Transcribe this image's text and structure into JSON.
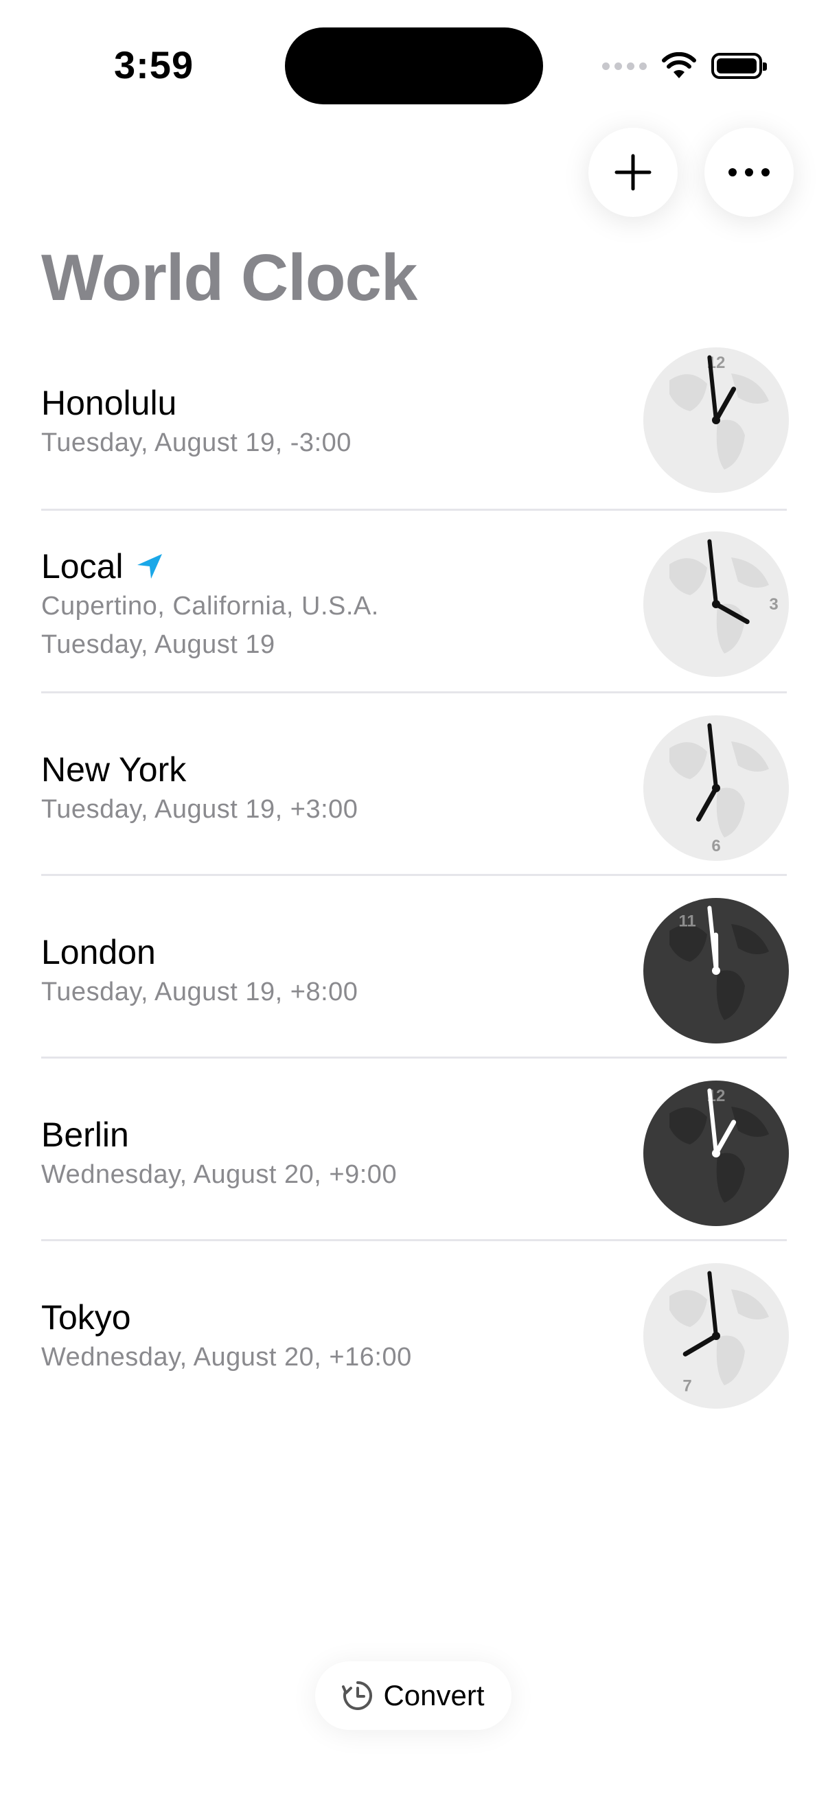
{
  "status": {
    "time": "3:59"
  },
  "header": {
    "title": "World Clock",
    "add_icon": "plus-icon",
    "more_icon": "ellipsis-icon"
  },
  "clocks": [
    {
      "city": "Honolulu",
      "line1": "Tuesday, August 19, -3:00",
      "line2": "",
      "hour": 12,
      "minute": 59,
      "dial_label": "12",
      "dark": false
    },
    {
      "city": "Local",
      "line1": "Cupertino, California, U.S.A.",
      "line2": "Tuesday, August 19",
      "hour": 3,
      "minute": 59,
      "dial_label": "3",
      "dark": false,
      "location_icon": "location-arrow-icon"
    },
    {
      "city": "New York",
      "line1": "Tuesday, August 19, +3:00",
      "line2": "",
      "hour": 6,
      "minute": 59,
      "dial_label": "6",
      "dark": false
    },
    {
      "city": "London",
      "line1": "Tuesday, August 19, +8:00",
      "line2": "",
      "hour": 11,
      "minute": 59,
      "dial_label": "11",
      "dark": true
    },
    {
      "city": "Berlin",
      "line1": "Wednesday, August 20, +9:00",
      "line2": "",
      "hour": 12,
      "minute": 59,
      "dial_label": "12",
      "dark": true
    },
    {
      "city": "Tokyo",
      "line1": "Wednesday, August 20, +16:00",
      "line2": "",
      "hour": 7,
      "minute": 59,
      "dial_label": "7",
      "dark": false
    }
  ],
  "footer": {
    "convert_label": "Convert",
    "convert_icon": "clock-arrow-icon"
  },
  "colors": {
    "accent": "#1aa7e8",
    "title_gray": "#86868b",
    "dark_face": "#3a3a3a",
    "light_face": "#ececec"
  }
}
